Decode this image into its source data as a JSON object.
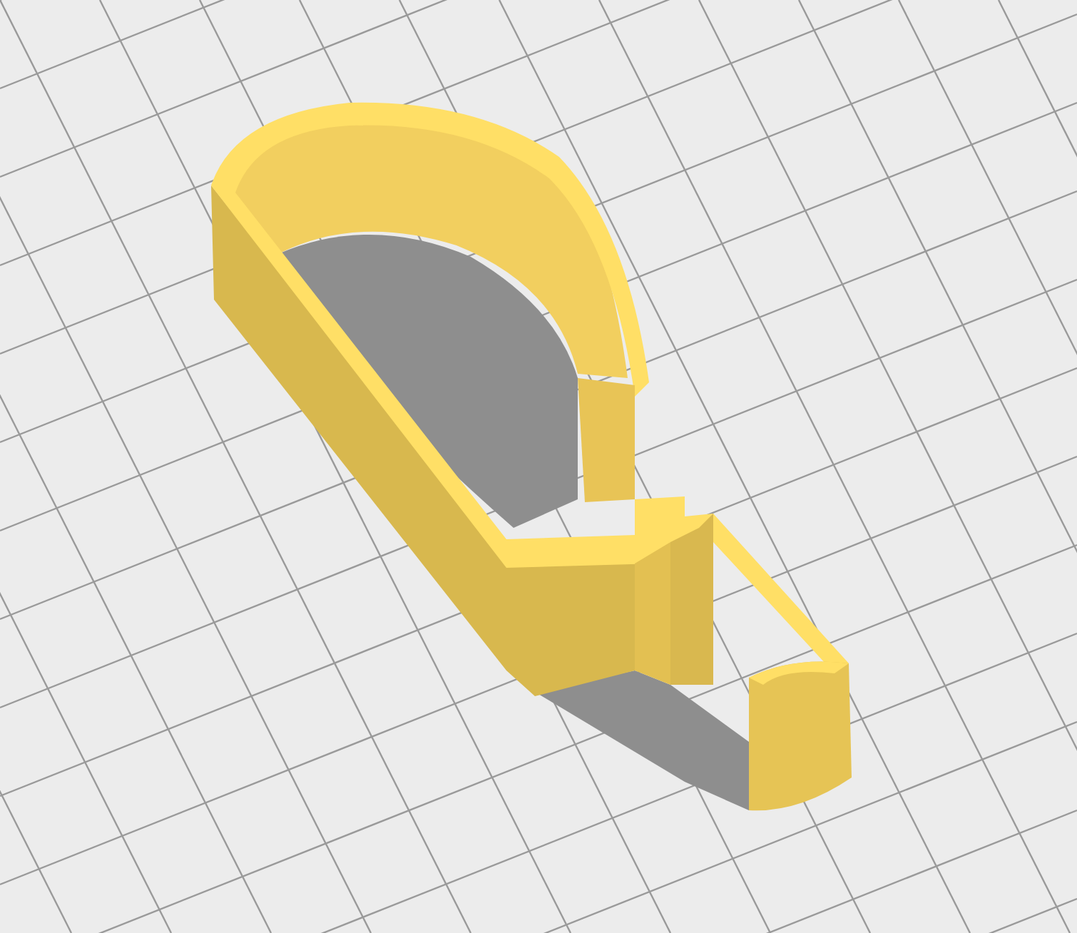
{
  "viewport": {
    "show_grid": true,
    "show_shadow": true
  }
}
